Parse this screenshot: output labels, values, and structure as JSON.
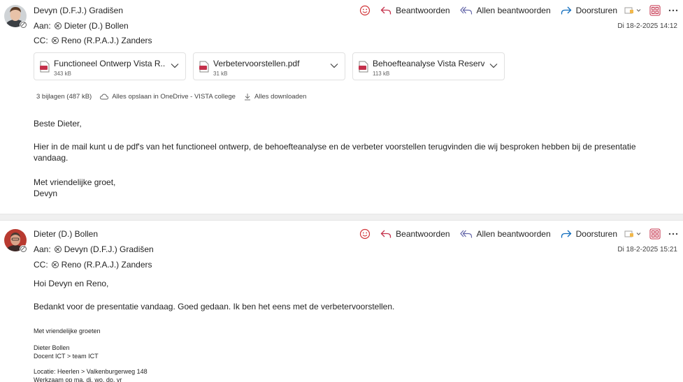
{
  "actions": {
    "reply": "Beantwoorden",
    "reply_all": "Allen beantwoorden",
    "forward": "Doorsturen"
  },
  "message1": {
    "sender": "Devyn (D.F.J.) Gradišen",
    "to_label": "Aan:",
    "to": "Dieter (D.) Bollen",
    "cc_label": "CC:",
    "cc": "Reno (R.P.A.J.) Zanders",
    "date": "Di 18-2-2025 14:12",
    "attachments": [
      {
        "name": "Functioneel Ontwerp Vista R...",
        "size": "343 kB"
      },
      {
        "name": "Verbetervoorstellen.pdf",
        "size": "31 kB"
      },
      {
        "name": "Behoefteanalyse Vista Reserv...",
        "size": "113 kB"
      }
    ],
    "attachment_bar": {
      "count": "3 bijlagen (487 kB)",
      "save_all": "Alles opslaan in OneDrive - VISTA college",
      "download_all": "Alles downloaden"
    },
    "greeting": "Beste Dieter,",
    "paragraph": "Hier in de mail kunt u de pdf's van het functioneel ontwerp, de behoefteanalyse en de verbeter voorstellen terugvinden die wij besproken hebben bij de presentatie vandaag.",
    "closing": "Met vriendelijke groet,",
    "signature": "Devyn"
  },
  "message2": {
    "sender": "Dieter (D.) Bollen",
    "to_label": "Aan:",
    "to": "Devyn (D.F.J.) Gradišen",
    "cc_label": "CC:",
    "cc": "Reno (R.P.A.J.) Zanders",
    "date": "Di 18-2-2025 15:21",
    "greeting": "Hoi Devyn en Reno,",
    "paragraph": "Bedankt voor de presentatie vandaag. Goed gedaan. Ik ben het eens met de verbetervoorstellen.",
    "closing": "Met vriendelijke groeten",
    "sig_name": "Dieter Bollen",
    "sig_role": "Docent ICT > team ICT",
    "sig_location": "Locatie: Heerlen > Valkenburgerweg 148",
    "sig_days": "Werkzaam op ma. di. wo. do. vr"
  },
  "colors": {
    "accent": "#6264a7",
    "reply_arrow": "#c4314b",
    "forward_arrow": "#0f6cbd",
    "emoji": "#d13438",
    "pdf_red": "#c4314b"
  }
}
